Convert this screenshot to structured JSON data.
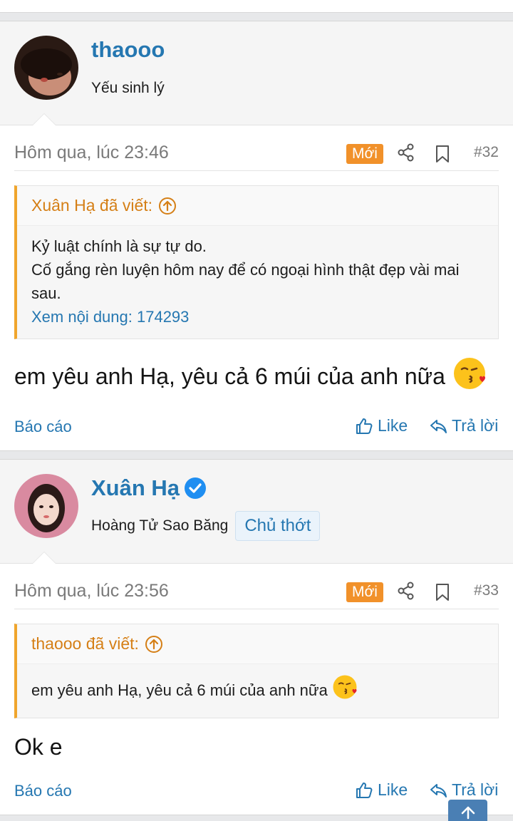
{
  "posts": [
    {
      "username": "thaooo",
      "user_title": "Yếu sinh lý",
      "date": "Hôm qua, lúc 23:46",
      "new_badge": "Mới",
      "post_number": "#32",
      "quote": {
        "author_line": "Xuân Hạ đã viết:",
        "lines": [
          "Kỷ luật chính là sự tự do.",
          "Cố gắng rèn luyện hôm nay để có ngoại hình thật đẹp vài mai sau."
        ],
        "link": "Xem nội dung: 174293"
      },
      "message": "em yêu anh Hạ, yêu cả 6 múi của anh nữa",
      "report_label": "Báo cáo",
      "like_label": "Like",
      "reply_label": "Trả lời"
    },
    {
      "username": "Xuân Hạ",
      "user_title": "Hoàng Tử Sao Băng",
      "owner_badge": "Chủ thớt",
      "date": "Hôm qua, lúc 23:56",
      "new_badge": "Mới",
      "post_number": "#33",
      "quote": {
        "author_line": "thaooo đã viết:",
        "text": "em yêu anh Hạ, yêu cả 6 múi của anh nữa"
      },
      "message": "Ok e",
      "report_label": "Báo cáo",
      "like_label": "Like",
      "reply_label": "Trả lời"
    }
  ],
  "icons": {
    "share": "share-icon",
    "bookmark": "bookmark-icon",
    "like": "thumbs-up-icon",
    "reply": "reply-icon",
    "quote_up": "arrow-up-circle-icon",
    "verified": "verified-check-icon",
    "emoji": "kissing-face-heart-emoji",
    "scroll_top": "arrow-up-icon"
  },
  "colors": {
    "link": "#2577b1",
    "quote_accent": "#f0a52c",
    "new_badge": "#f1912a"
  }
}
